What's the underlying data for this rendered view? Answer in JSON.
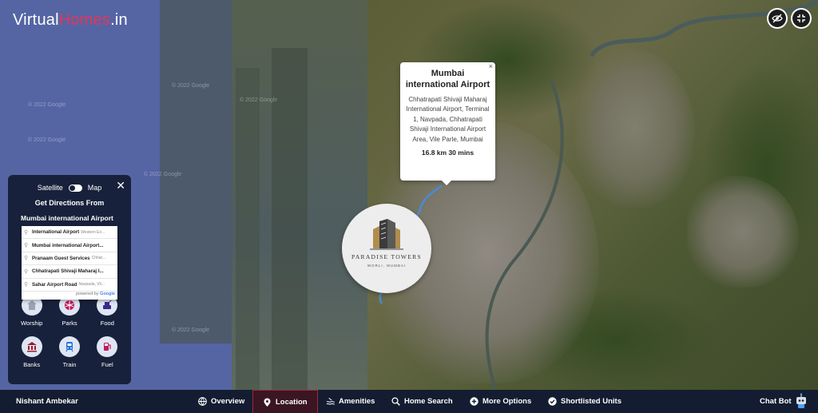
{
  "brand": {
    "logo_prefix": "Virtual",
    "logo_accent": "Homes",
    "logo_suffix": ".in",
    "accent_color": "#e0365a"
  },
  "map": {
    "watermark": "© 2022 Google"
  },
  "top_controls": {
    "icons": [
      "eye-slash-icon",
      "compress-icon"
    ]
  },
  "popup": {
    "title": "Mumbai international Airport",
    "address": "Chhatrapati Shivaji Maharaj International Airport, Terminal 1, Navpada, Chhatrapati Shivaji International Airport Area, Vile Parle, Mumbai",
    "distance": "16.8 km 30 mins",
    "close": "×"
  },
  "marker": {
    "name": "PARADISE TOWERS",
    "subtitle": "WORLI, MUMBAI"
  },
  "panel": {
    "close": "✕",
    "satellite_label": "Satellite",
    "map_label": "Map",
    "directions_title": "Get Directions From",
    "directions_value": "Mumbai international Airport",
    "categories": [
      {
        "label": "Worship",
        "icon": "worship-icon"
      },
      {
        "label": "Parks",
        "icon": "parks-icon"
      },
      {
        "label": "Food",
        "icon": "food-icon"
      },
      {
        "label": "Banks",
        "icon": "bank-icon"
      },
      {
        "label": "Train",
        "icon": "train-icon"
      },
      {
        "label": "Fuel",
        "icon": "fuel-icon"
      }
    ]
  },
  "autocomplete": {
    "suggestions": [
      {
        "main": "International Airport",
        "secondary": "Western Ex..."
      },
      {
        "main": "Mumbai international Airport...",
        "secondary": ""
      },
      {
        "main": "Pranaam Guest Services",
        "secondary": "Chhat..."
      },
      {
        "main": "Chhatrapati Shivaji Maharaj I...",
        "secondary": ""
      },
      {
        "main": "Sahar Airport Road",
        "secondary": "Navpada, Vil..."
      }
    ],
    "powered_prefix": "powered by",
    "powered_brand": "Google"
  },
  "bottom_bar": {
    "user_name": "Nishant Ambekar",
    "nav": [
      {
        "label": "Overview",
        "icon": "globe-icon",
        "active": false
      },
      {
        "label": "Location",
        "icon": "location-pin-icon",
        "active": true
      },
      {
        "label": "Amenities",
        "icon": "amenities-icon",
        "active": false
      },
      {
        "label": "Home Search",
        "icon": "search-icon",
        "active": false
      },
      {
        "label": "More Options",
        "icon": "plus-circle-icon",
        "active": false
      },
      {
        "label": "Shortlisted Units",
        "icon": "check-circle-icon",
        "active": false
      }
    ],
    "chat_label": "Chat Bot"
  }
}
